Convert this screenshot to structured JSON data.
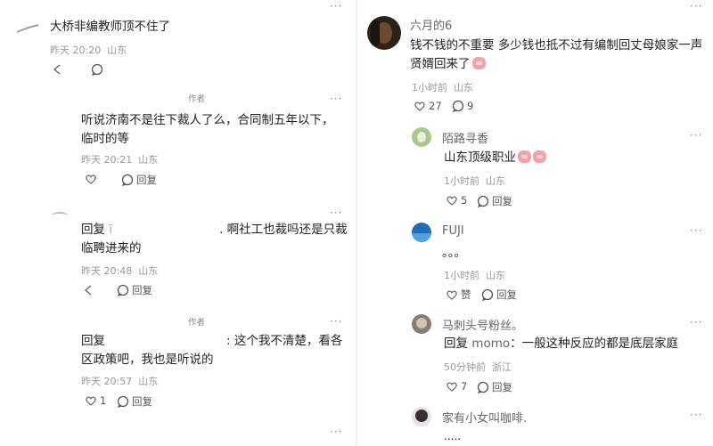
{
  "left": {
    "top_more": "···",
    "root": {
      "text": "大桥非编教师顶不住了",
      "time": "昨天 20:20",
      "location": "山东"
    },
    "reply1": {
      "author_tag": "作者",
      "more": "···",
      "text": "听说济南不是往下裁人了么，合同制五年以下，临时的等",
      "time": "昨天 20:21",
      "location": "山东",
      "reply_label": "回复"
    },
    "reply2": {
      "more": "···",
      "prefix": "回复",
      "text": ". 啊社工也裁吗还是只裁临聘进来的",
      "time": "昨天 20:48",
      "location": "山东",
      "reply_label": "回复"
    },
    "reply3": {
      "author_tag": "作者",
      "more": "···",
      "prefix": "回复",
      "text": ": 这个我不清楚，看各区政策吧，我也是听说的",
      "time": "昨天 20:57",
      "location": "山东",
      "likes": "1",
      "reply_label": "回复"
    },
    "bottom_more": "···"
  },
  "right": {
    "top_more": "···",
    "main": {
      "author": "六月的6",
      "text": "钱不钱的不重要 多少钱也抵不过有编制回丈母娘家一声贤婿回来了",
      "time": "1小时前",
      "location": "山东",
      "likes": "27",
      "replies": "9"
    },
    "c1": {
      "author": "陌路寻香",
      "text": "山东顶级职业",
      "time": "1小时前",
      "location": "山东",
      "likes": "5",
      "reply_label": "回复",
      "more": "···"
    },
    "c2": {
      "author": "FUJI",
      "text": "。。。",
      "time": "1小时前",
      "location": "山东",
      "like_label": "赞",
      "reply_label": "回复",
      "more": "···"
    },
    "c3": {
      "author": "马刺头号粉丝。",
      "prefix": "回复 ",
      "mention": "momo",
      "text": "：一般这种反应的都是底层家庭",
      "time": "50分钟前",
      "location": "浙江",
      "likes": "7",
      "reply_label": "回复",
      "more": "···"
    },
    "c4": {
      "author": "家有小女叫咖啡.",
      "text": ".....",
      "more": "···"
    }
  }
}
